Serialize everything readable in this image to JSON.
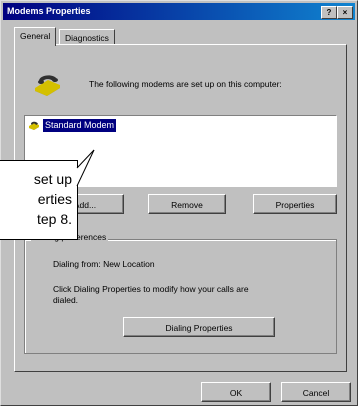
{
  "window": {
    "title": "Modems Properties",
    "help_glyph": "?",
    "close_glyph": "×"
  },
  "tabs": [
    {
      "label": "General"
    },
    {
      "label": "Diagnostics"
    }
  ],
  "header_text": "The following modems are set up on this computer:",
  "modems": [
    {
      "label": "Standard Modem"
    }
  ],
  "buttons": {
    "add": "Add...",
    "remove": "Remove",
    "properties": "Properties",
    "dialing_properties": "Dialing Properties",
    "ok": "OK",
    "cancel": "Cancel"
  },
  "dialing": {
    "group_label": "Dialing preferences",
    "dialing_from": "Dialing from:  New Location",
    "hint_line1": "Click Dialing Properties to modify how your calls are",
    "hint_line2": "dialed."
  },
  "callout": {
    "line1": "set up",
    "line2": "erties",
    "line3": "tep 8."
  },
  "colors": {
    "titlebar_start": "#000080",
    "titlebar_end": "#1084d0",
    "selection": "#000080",
    "face": "#c0c0c0"
  },
  "icons": {
    "modem": "modem-phone-icon"
  }
}
